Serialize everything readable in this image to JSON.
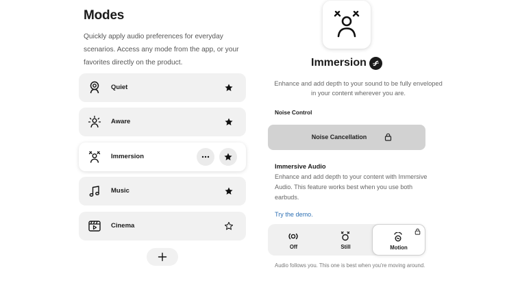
{
  "left": {
    "title": "Modes",
    "description": "Quickly apply audio preferences for everyday scenarios. Access any mode from the app, or your favorites directly on the product.",
    "modes": [
      {
        "label": "Quiet",
        "icon": "quiet-icon",
        "favorite": true,
        "active": false
      },
      {
        "label": "Aware",
        "icon": "aware-icon",
        "favorite": true,
        "active": false
      },
      {
        "label": "Immersion",
        "icon": "immersion-icon",
        "favorite": true,
        "active": true
      },
      {
        "label": "Music",
        "icon": "music-note-icon",
        "favorite": true,
        "active": false
      },
      {
        "label": "Cinema",
        "icon": "cinema-icon",
        "favorite": false,
        "active": false
      }
    ],
    "add_button": "+"
  },
  "right": {
    "mode_title": "Immersion",
    "mode_description": "Enhance and add depth to your sound to be fully enveloped in your content wherever you are.",
    "noise_control_label": "Noise Control",
    "noise_cancellation_button": "Noise Cancellation",
    "immersive_audio_title": "Immersive Audio",
    "immersive_audio_description": "Enhance and add depth to your content with Immersive Audio. This feature works best when you use both earbuds.",
    "demo_link": "Try the demo.",
    "segments": [
      {
        "label": "Off",
        "icon": "off-icon",
        "selected": false
      },
      {
        "label": "Still",
        "icon": "still-icon",
        "selected": false
      },
      {
        "label": "Motion",
        "icon": "motion-icon",
        "selected": true
      }
    ],
    "footer_note": "Audio follows you. This one is best when you're moving around."
  }
}
